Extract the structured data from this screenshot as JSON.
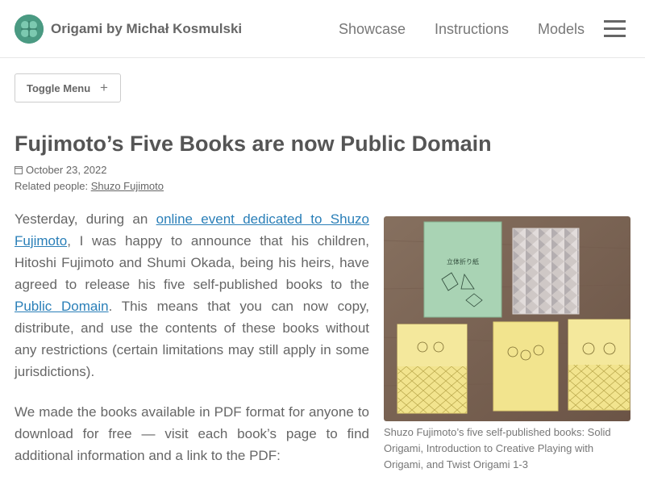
{
  "header": {
    "site_title": "Origami by Michał Kosmulski",
    "nav": [
      "Showcase",
      "Instructions",
      "Models"
    ]
  },
  "toggle_menu": {
    "label": "Toggle Menu",
    "icon": "plus-icon"
  },
  "article": {
    "title": "Fujimoto’s Five Books are now Public Domain",
    "date": "October 23, 2022",
    "related_label": "Related people: ",
    "related_person": "Shuzo Fujimoto",
    "p1_before": "Yesterday, during an ",
    "p1_link1": "online event dedicated to Shuzo Fujimoto",
    "p1_mid": ", I was happy to announce that his children, Hitoshi Fujimoto and Shumi Okada, being his heirs, have agreed to release his five self-published books to the ",
    "p1_link2": "Public Domain",
    "p1_after": ". This means that you can now copy, distribute, and use the contents of these books without any restrictions (certain limitations may still apply in some jurisdictions).",
    "p2": "We made the books available in PDF format for anyone to download for free — visit each book’s page to find additional information and a link to the PDF:"
  },
  "figure": {
    "caption": "Shuzo Fujimoto’s five self-published books: Solid Origami, Introduction to Creative Playing with Origami, and Twist Origami 1-3",
    "book_title_text": "立体折り紙"
  },
  "colors": {
    "link": "#2a7fb8",
    "logo": "#4a9a82",
    "wood": "#7a6150"
  }
}
